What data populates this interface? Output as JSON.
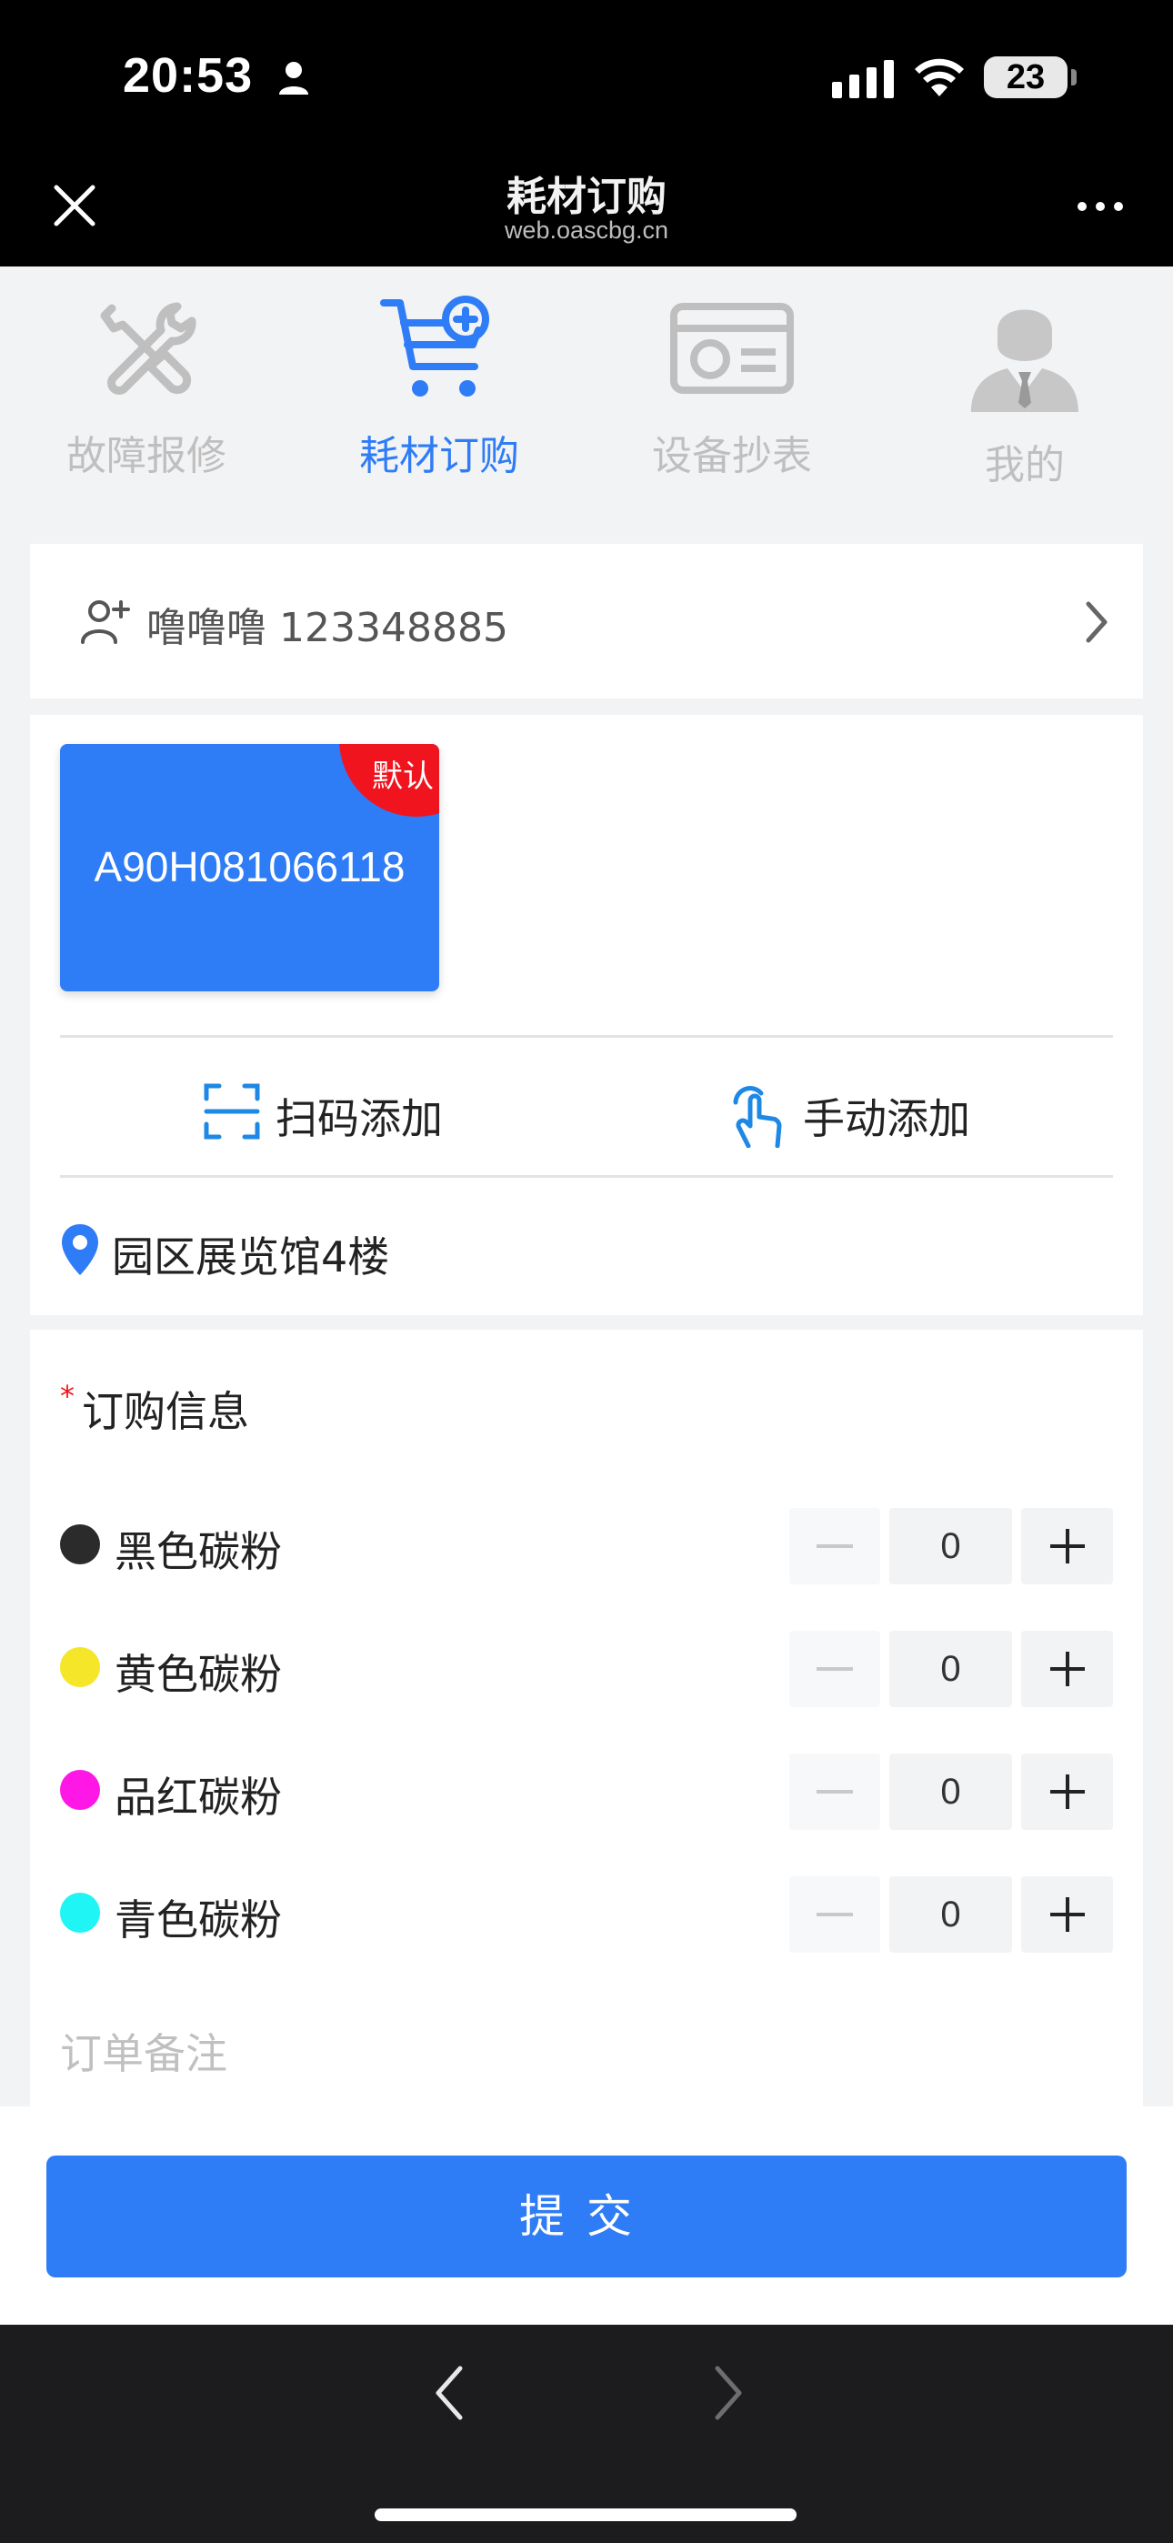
{
  "status_bar": {
    "time": "20:53",
    "battery": "23"
  },
  "header": {
    "title": "耗材订购",
    "subtitle": "web.oascbg.cn"
  },
  "tabs": [
    {
      "label": "故障报修",
      "icon": "wrench-screwdriver-icon",
      "active": false
    },
    {
      "label": "耗材订购",
      "icon": "cart-plus-icon",
      "active": true
    },
    {
      "label": "设备抄表",
      "icon": "meter-card-icon",
      "active": false
    },
    {
      "label": "我的",
      "icon": "user-avatar-icon",
      "active": false
    }
  ],
  "contact": {
    "text": "噜噜噜 123348885"
  },
  "device": {
    "id": "A90H081066118",
    "badge": "默认"
  },
  "actions": {
    "scan_add": "扫码添加",
    "manual_add": "手动添加"
  },
  "location": {
    "text": "园区展览馆4楼"
  },
  "order": {
    "title": "订购信息",
    "required_mark": "*",
    "items": [
      {
        "name": "黑色碳粉",
        "color": "#2b2b2b",
        "qty": "0"
      },
      {
        "name": "黄色碳粉",
        "color": "#f5e62a",
        "qty": "0"
      },
      {
        "name": "品红碳粉",
        "color": "#ff17e6",
        "qty": "0"
      },
      {
        "name": "青色碳粉",
        "color": "#1ff5f5",
        "qty": "0"
      }
    ],
    "remark_placeholder": "订单备注"
  },
  "submit": {
    "label": "提交"
  },
  "colors": {
    "accent": "#2e7cf6",
    "badge": "#f0141e"
  }
}
